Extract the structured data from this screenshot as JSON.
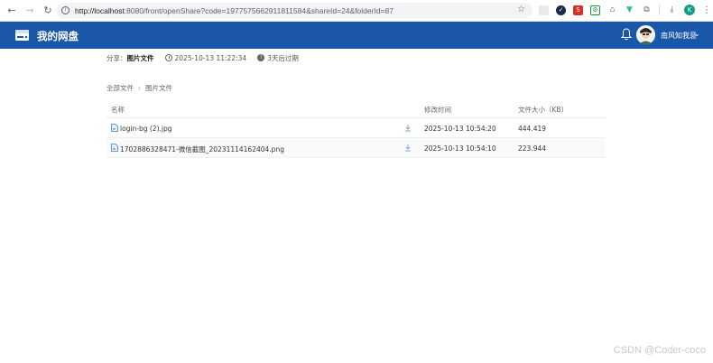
{
  "browser": {
    "url_host": "http://localhost",
    "url_rest": ":8080/front/openShare?code=1977575662911811584&shareId=24&folderId=87"
  },
  "app": {
    "title": "我的网盘",
    "user_name": "南风知我意"
  },
  "share": {
    "label": "分享：",
    "name": "图片文件",
    "time": "2025-10-13 11:22:34",
    "expire": "3天后过期"
  },
  "breadcrumb": {
    "root": "全部文件",
    "sep": "›",
    "current": "图片文件"
  },
  "table": {
    "headers": {
      "name": "名称",
      "modified": "修改时间",
      "size": "文件大小（KB）"
    },
    "rows": [
      {
        "name": "login-bg (2).jpg",
        "modified": "2025-10-13 10:54:20",
        "size": "444.419"
      },
      {
        "name": "1702886328471-微信截图_20231114162404.png",
        "modified": "2025-10-13 10:54:10",
        "size": "223.944"
      }
    ]
  },
  "watermark": "CSDN @Coder-coco",
  "colors": {
    "header_bg": "#1a57a8",
    "link_icon": "#3a7bd5"
  }
}
